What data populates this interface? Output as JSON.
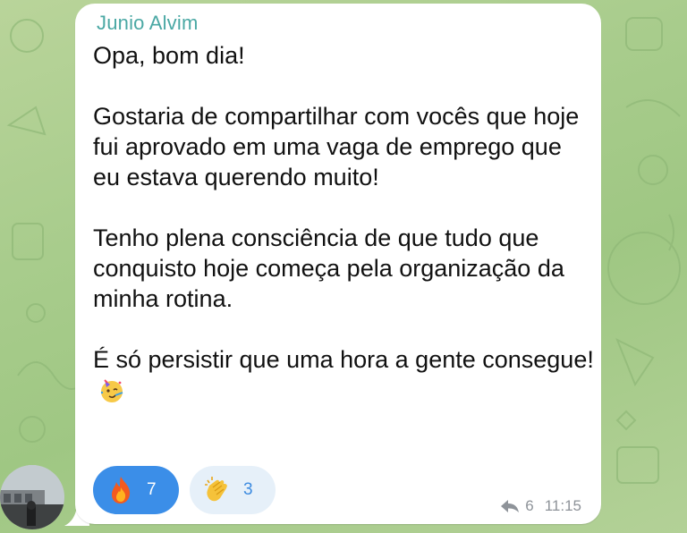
{
  "message": {
    "sender": "Junio Alvim",
    "paragraphs": [
      "Opa, bom dia!",
      "Gostaria de compartilhar com vocês que hoje fui aprovado em uma vaga de emprego que eu estava querendo muito!",
      "Tenho plena consciência de que tudo que conquisto hoje começa pela organização da minha rotina.",
      "É só persistir que uma hora a gente consegue!"
    ],
    "trailing_emoji": "partying-face-icon"
  },
  "reactions": [
    {
      "emoji": "fire-icon",
      "count": "7",
      "selected": true,
      "color": "#3b8ee8"
    },
    {
      "emoji": "clapping-hands-icon",
      "count": "3",
      "selected": false,
      "color": "#e6f0f9"
    }
  ],
  "meta": {
    "forwards": "6",
    "time": "11:15"
  },
  "colors": {
    "sender": "#4aa8a4",
    "background": "#a8cc8c",
    "bubble": "#ffffff"
  }
}
